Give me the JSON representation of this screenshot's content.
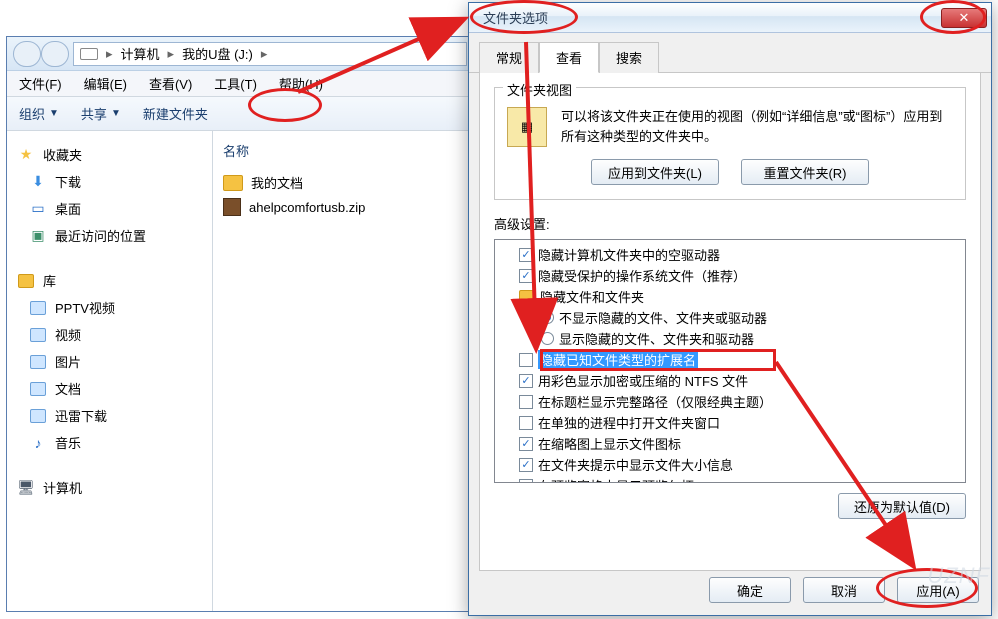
{
  "explorer": {
    "breadcrumb": {
      "c1": "计算机",
      "c2": "我的U盘 (J:)"
    },
    "menu": {
      "file": "文件(F)",
      "edit": "编辑(E)",
      "view": "查看(V)",
      "tools": "工具(T)",
      "help": "帮助(H)"
    },
    "toolbar": {
      "organize": "组织",
      "share": "共享",
      "newfolder": "新建文件夹"
    },
    "sidebar": {
      "favorites": "收藏夹",
      "downloads": "下载",
      "desktop": "桌面",
      "recent": "最近访问的位置",
      "libraries": "库",
      "pptv": "PPTV视频",
      "video": "视频",
      "pictures": "图片",
      "documents": "文档",
      "thunder": "迅雷下载",
      "music": "音乐",
      "computer": "计算机"
    },
    "content": {
      "col_name": "名称",
      "file1": "我的文档",
      "file2": "ahelpcomfortusb.zip"
    }
  },
  "dialog": {
    "title": "文件夹选项",
    "tabs": {
      "general": "常规",
      "view": "查看",
      "search": "搜索"
    },
    "fieldset": {
      "legend": "文件夹视图",
      "desc": "可以将该文件夹正在使用的视图（例如“详细信息”或“图标”）应用到所有这种类型的文件夹中。",
      "apply_btn": "应用到文件夹(L)",
      "reset_btn": "重置文件夹(R)"
    },
    "adv_label": "高级设置:",
    "tree": {
      "r1": "隐藏计算机文件夹中的空驱动器",
      "r2": "隐藏受保护的操作系统文件（推荐）",
      "r3": "隐藏文件和文件夹",
      "r3a": "不显示隐藏的文件、文件夹或驱动器",
      "r3b": "显示隐藏的文件、文件夹和驱动器",
      "r4": "隐藏已知文件类型的扩展名",
      "r5": "用彩色显示加密或压缩的 NTFS 文件",
      "r6": "在标题栏显示完整路径（仅限经典主题）",
      "r7": "在单独的进程中打开文件夹窗口",
      "r8": "在缩略图上显示文件图标",
      "r9": "在文件夹提示中显示文件大小信息",
      "r10": "在预览窗格中显示预览句柄"
    },
    "restore": "还原为默认值(D)",
    "ok": "确定",
    "cancel": "取消",
    "apply": "应用(A)"
  },
  "watermark": "UZNF"
}
